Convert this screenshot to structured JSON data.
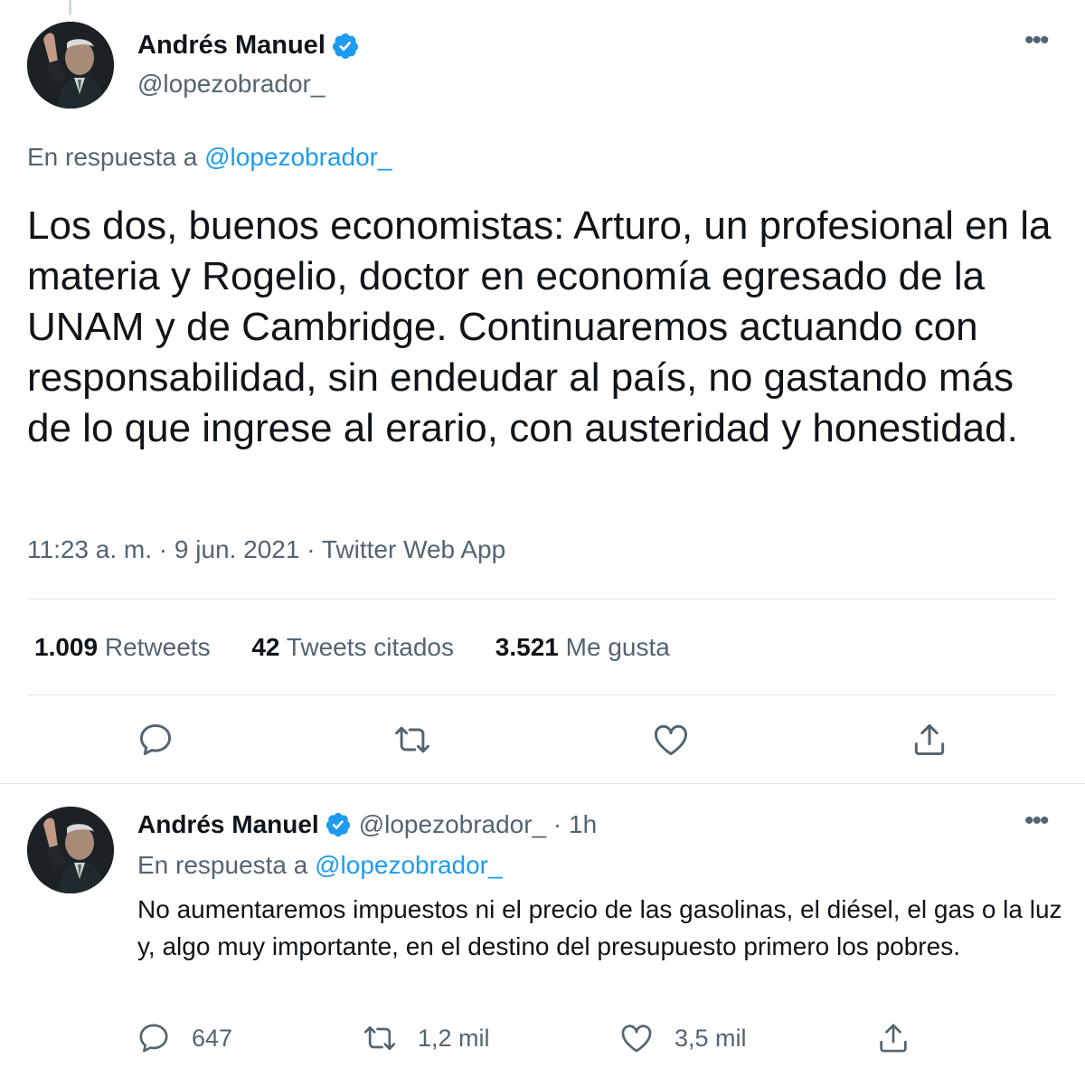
{
  "main_tweet": {
    "author_name": "Andrés Manuel",
    "author_handle": "@lopezobrador_",
    "in_reply_prefix": "En respuesta a",
    "in_reply_handle": "@lopezobrador_",
    "text": "Los dos, buenos economistas: Arturo, un profesional en la materia y Rogelio, doctor en economía egresado de la UNAM y de Cambridge. Continuaremos actuando con responsabilidad, sin endeudar al país, no gastando más de lo que ingrese al erario, con austeridad y honestidad.",
    "timestamp": "11:23 a. m. · 9 jun. 2021 · Twitter Web App",
    "stats": {
      "retweets_count": "1.009",
      "retweets_label": "Retweets",
      "quotes_count": "42",
      "quotes_label": "Tweets citados",
      "likes_count": "3.521",
      "likes_label": "Me gusta"
    },
    "actions": [
      "reply-icon",
      "retweet-icon",
      "like-icon",
      "share-icon"
    ]
  },
  "reply_tweet": {
    "author_name": "Andrés Manuel",
    "handle_time": "@lopezobrador_ · 1h",
    "in_reply_prefix": "En respuesta a",
    "in_reply_handle": "@lopezobrador_",
    "text": "No aumentaremos impuestos ni el precio de las gasolinas, el diésel, el gas o la luz y, algo muy importante, en el destino del presupuesto primero los pobres.",
    "reply_count": "647",
    "retweet_count": "1,2 mil",
    "like_count": "3,5 mil"
  },
  "colors": {
    "accent": "#1d9bf0",
    "text_primary": "#0f1419",
    "text_secondary": "#536471",
    "divider": "#e1e8ed"
  }
}
